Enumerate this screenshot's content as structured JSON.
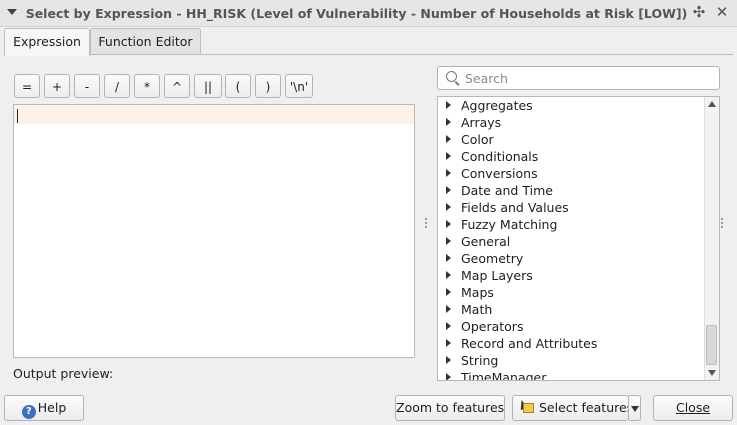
{
  "window": {
    "title": "Select by Expression - HH_RISK (Level of Vulnerability - Number of Households at Risk [LOW])",
    "pin_glyph": "✣",
    "close_glyph": "✕"
  },
  "tabs": [
    {
      "label": "Expression",
      "active": true
    },
    {
      "label": "Function Editor",
      "active": false
    }
  ],
  "operators": [
    "=",
    "+",
    "-",
    "/",
    "*",
    "^",
    "||",
    "(",
    ")",
    "'\\n'"
  ],
  "editor": {
    "value": ""
  },
  "output_preview_label": "Output preview:",
  "search": {
    "placeholder": "Search",
    "value": ""
  },
  "function_groups": [
    "Aggregates",
    "Arrays",
    "Color",
    "Conditionals",
    "Conversions",
    "Date and Time",
    "Fields and Values",
    "Fuzzy Matching",
    "General",
    "Geometry",
    "Map Layers",
    "Maps",
    "Math",
    "Operators",
    "Record and Attributes",
    "String",
    "TimeManager"
  ],
  "buttons": {
    "help": "Help",
    "zoom": "Zoom to features",
    "select": "Select features",
    "close": "Close"
  },
  "icons": {
    "help": "help-icon",
    "select": "select-features-icon",
    "search": "search-icon"
  }
}
